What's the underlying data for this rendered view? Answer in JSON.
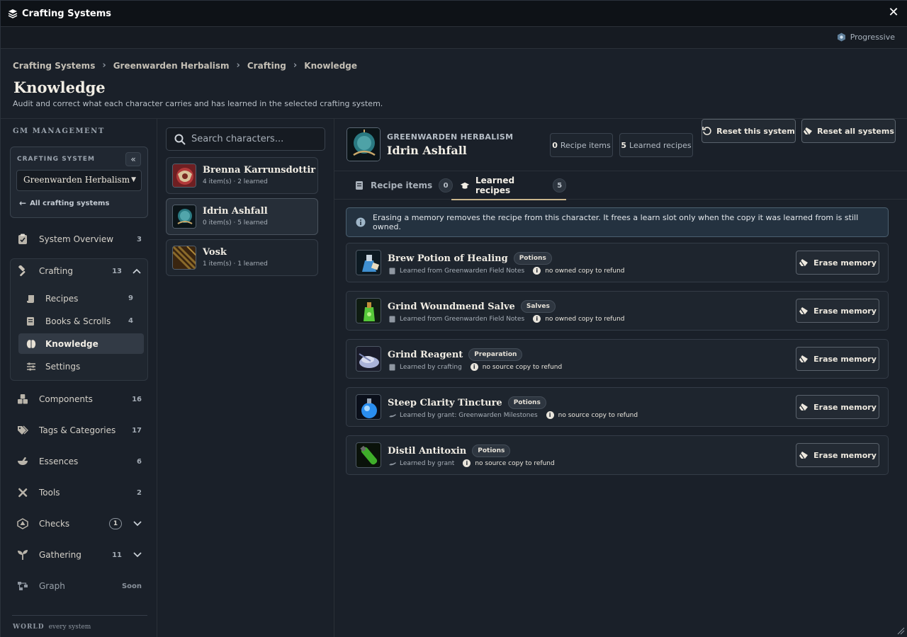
{
  "window": {
    "title": "Crafting Systems",
    "close_icon": "close-icon"
  },
  "mode": {
    "label": "Progressive"
  },
  "breadcrumbs": [
    "Crafting Systems",
    "Greenwarden Herbalism",
    "Crafting",
    "Knowledge"
  ],
  "page": {
    "title": "Knowledge",
    "description": "Audit and correct what each character carries and has learned in the selected crafting system."
  },
  "sidebar": {
    "section_label": "GM MANAGEMENT",
    "system_label": "CRAFTING SYSTEM",
    "selected_system": "Greenwarden Herbalism",
    "back_link": "All crafting systems",
    "items": [
      {
        "label": "System Overview",
        "count": "3",
        "icon": "clipboard-icon"
      },
      {
        "label": "Crafting",
        "count": "13",
        "icon": "hammer-icon"
      },
      {
        "label": "Components",
        "count": "16",
        "icon": "boxes-icon"
      },
      {
        "label": "Tags & Categories",
        "count": "17",
        "icon": "tags-icon"
      },
      {
        "label": "Essences",
        "count": "6",
        "icon": "mortar-icon"
      },
      {
        "label": "Tools",
        "count": "2",
        "icon": "tools-icon"
      },
      {
        "label": "Checks",
        "count": "1",
        "icon": "dice-icon"
      },
      {
        "label": "Gathering",
        "count": "11",
        "icon": "seedling-icon"
      },
      {
        "label": "Graph",
        "count": "Soon",
        "icon": "graph-icon"
      }
    ],
    "crafting_sub": [
      {
        "label": "Recipes",
        "count": "9",
        "icon": "scroll-icon"
      },
      {
        "label": "Books & Scrolls",
        "count": "4",
        "icon": "book-icon"
      },
      {
        "label": "Knowledge",
        "count": "",
        "icon": "brain-icon"
      },
      {
        "label": "Settings",
        "count": "",
        "icon": "sliders-icon"
      }
    ],
    "world_label": "WORLD",
    "world_sub": "every system"
  },
  "characters": {
    "search_placeholder": "Search characters...",
    "list": [
      {
        "name": "Brenna Karrunsdottir",
        "meta": "4 item(s) · 2 learned"
      },
      {
        "name": "Idrin Ashfall",
        "meta": "0 item(s) · 5 learned"
      },
      {
        "name": "Vosk",
        "meta": "1 item(s) · 1 learned"
      }
    ]
  },
  "selected": {
    "system": "GREENWARDEN HERBALISM",
    "name": "Idrin Ashfall",
    "recipe_items_count": "0",
    "recipe_items_label": "Recipe items",
    "learned_count": "5",
    "learned_label": "Learned recipes",
    "reset_system": "Reset this system",
    "reset_all": "Reset all systems"
  },
  "tabs": [
    {
      "label": "Recipe items",
      "count": "0"
    },
    {
      "label": "Learned recipes",
      "count": "5"
    }
  ],
  "notice": "Erasing a memory removes the recipe from this character. It frees a learn slot only when the copy it was learned from is still owned.",
  "erase_label": "Erase memory",
  "recipes": [
    {
      "name": "Brew Potion of Healing",
      "tag": "Potions",
      "source": "Learned from Greenwarden Field Notes",
      "refund": "no owned copy to refund"
    },
    {
      "name": "Grind Woundmend Salve",
      "tag": "Salves",
      "source": "Learned from Greenwarden Field Notes",
      "refund": "no owned copy to refund"
    },
    {
      "name": "Grind Reagent",
      "tag": "Preparation",
      "source": "Learned by crafting",
      "refund": "no source copy to refund"
    },
    {
      "name": "Steep Clarity Tincture",
      "tag": "Potions",
      "source": "Learned by grant: Greenwarden Milestones",
      "refund": "no source copy to refund"
    },
    {
      "name": "Distil Antitoxin",
      "tag": "Potions",
      "source": "Learned by grant",
      "refund": "no source copy to refund"
    }
  ]
}
